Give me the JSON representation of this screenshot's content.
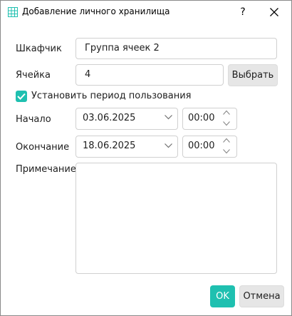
{
  "window": {
    "title": "Добавление личного хранилища",
    "help_label": "?",
    "icons": {
      "app": "table-grid-icon",
      "close": "close-icon"
    }
  },
  "form": {
    "locker": {
      "label": "Шкафчик",
      "value": "Группа ячеек 2"
    },
    "cell": {
      "label": "Ячейка",
      "value": "4",
      "select_button": "Выбрать"
    },
    "set_period": {
      "label": "Установить период пользования",
      "checked": true
    },
    "start": {
      "label": "Начало",
      "date": "03.06.2025",
      "time": "00:00"
    },
    "end": {
      "label": "Окончание",
      "date": "18.06.2025",
      "time": "00:00"
    },
    "note": {
      "label": "Примечание",
      "value": ""
    }
  },
  "buttons": {
    "ok": "OK",
    "cancel": "Отмена"
  },
  "colors": {
    "accent": "#1fc0b0",
    "border": "#d0d0d0",
    "button_gray": "#e6e6e6"
  }
}
